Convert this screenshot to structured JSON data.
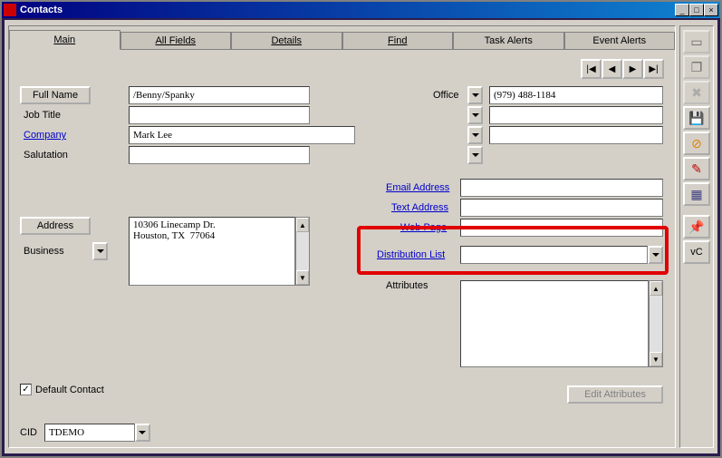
{
  "window": {
    "title": "Contacts"
  },
  "tabs": [
    {
      "label": "Main"
    },
    {
      "label": "All Fields"
    },
    {
      "label": "Details"
    },
    {
      "label": "Find"
    },
    {
      "label": "Task Alerts"
    },
    {
      "label": "Event Alerts"
    }
  ],
  "labels": {
    "full_name": "Full Name",
    "job_title": "Job Title",
    "company": "Company",
    "salutation": "Salutation",
    "address": "Address",
    "business": "Business",
    "office": "Office",
    "email": "Email Address",
    "text_addr": "Text Address",
    "webpage": "Web Page",
    "dist_list": "Distribution List",
    "attributes": "Attributes",
    "default_contact": "Default Contact",
    "edit_attributes": "Edit Attributes",
    "cid": "CID"
  },
  "values": {
    "full_name": "/Benny/Spanky",
    "job_title": "",
    "company": "Mark Lee",
    "salutation": "",
    "address": "10306 Linecamp Dr.\nHouston, TX  77064",
    "phone1": "(979) 488-1184",
    "phone2": "",
    "phone3": "",
    "email": "",
    "text_addr": "",
    "webpage": "",
    "dist_list": "",
    "attributes": "",
    "default_contact_checked": true,
    "cid": "TDEMO"
  },
  "side_toolbar": {
    "vc_label": "vC"
  },
  "icons": {
    "save": "💾",
    "cancel": "⊘",
    "edit": "✎",
    "props": "▦",
    "attach": "📎"
  }
}
